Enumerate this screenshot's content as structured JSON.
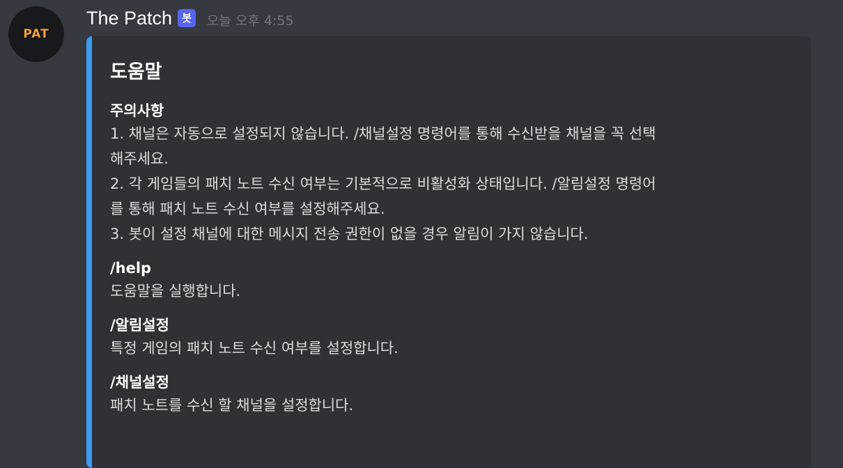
{
  "message": {
    "avatar_text": "PAT",
    "author": "The Patch",
    "bot_tag": "봇",
    "timestamp": "오늘 오후 4:55"
  },
  "embed": {
    "accent_color": "#3e9bf5",
    "title": "도움말",
    "fields": [
      {
        "name": "주의사항",
        "lines": [
          "1. 채널은 자동으로 설정되지 않습니다. /채널설정 명령어를 통해 수신받을 채널을 꼭 선택",
          "해주세요.",
          "2. 각 게임들의 패치 노트 수신 여부는 기본적으로 비활성화 상태입니다. /알림설정 명령어",
          "를 통해 패치 노트 수신 여부를 설정해주세요.",
          "3. 봇이 설정 채널에 대한 메시지 전송 권한이 없을 경우 알림이 가지 않습니다."
        ]
      },
      {
        "name": "/help",
        "value": "도움말을 실행합니다."
      },
      {
        "name": "/알림설정",
        "value": "특정 게임의 패치 노트 수신 여부를 설정합니다."
      },
      {
        "name": "/채널설정",
        "value": "패치 노트를 수신 할 채널을 설정합니다."
      }
    ]
  }
}
